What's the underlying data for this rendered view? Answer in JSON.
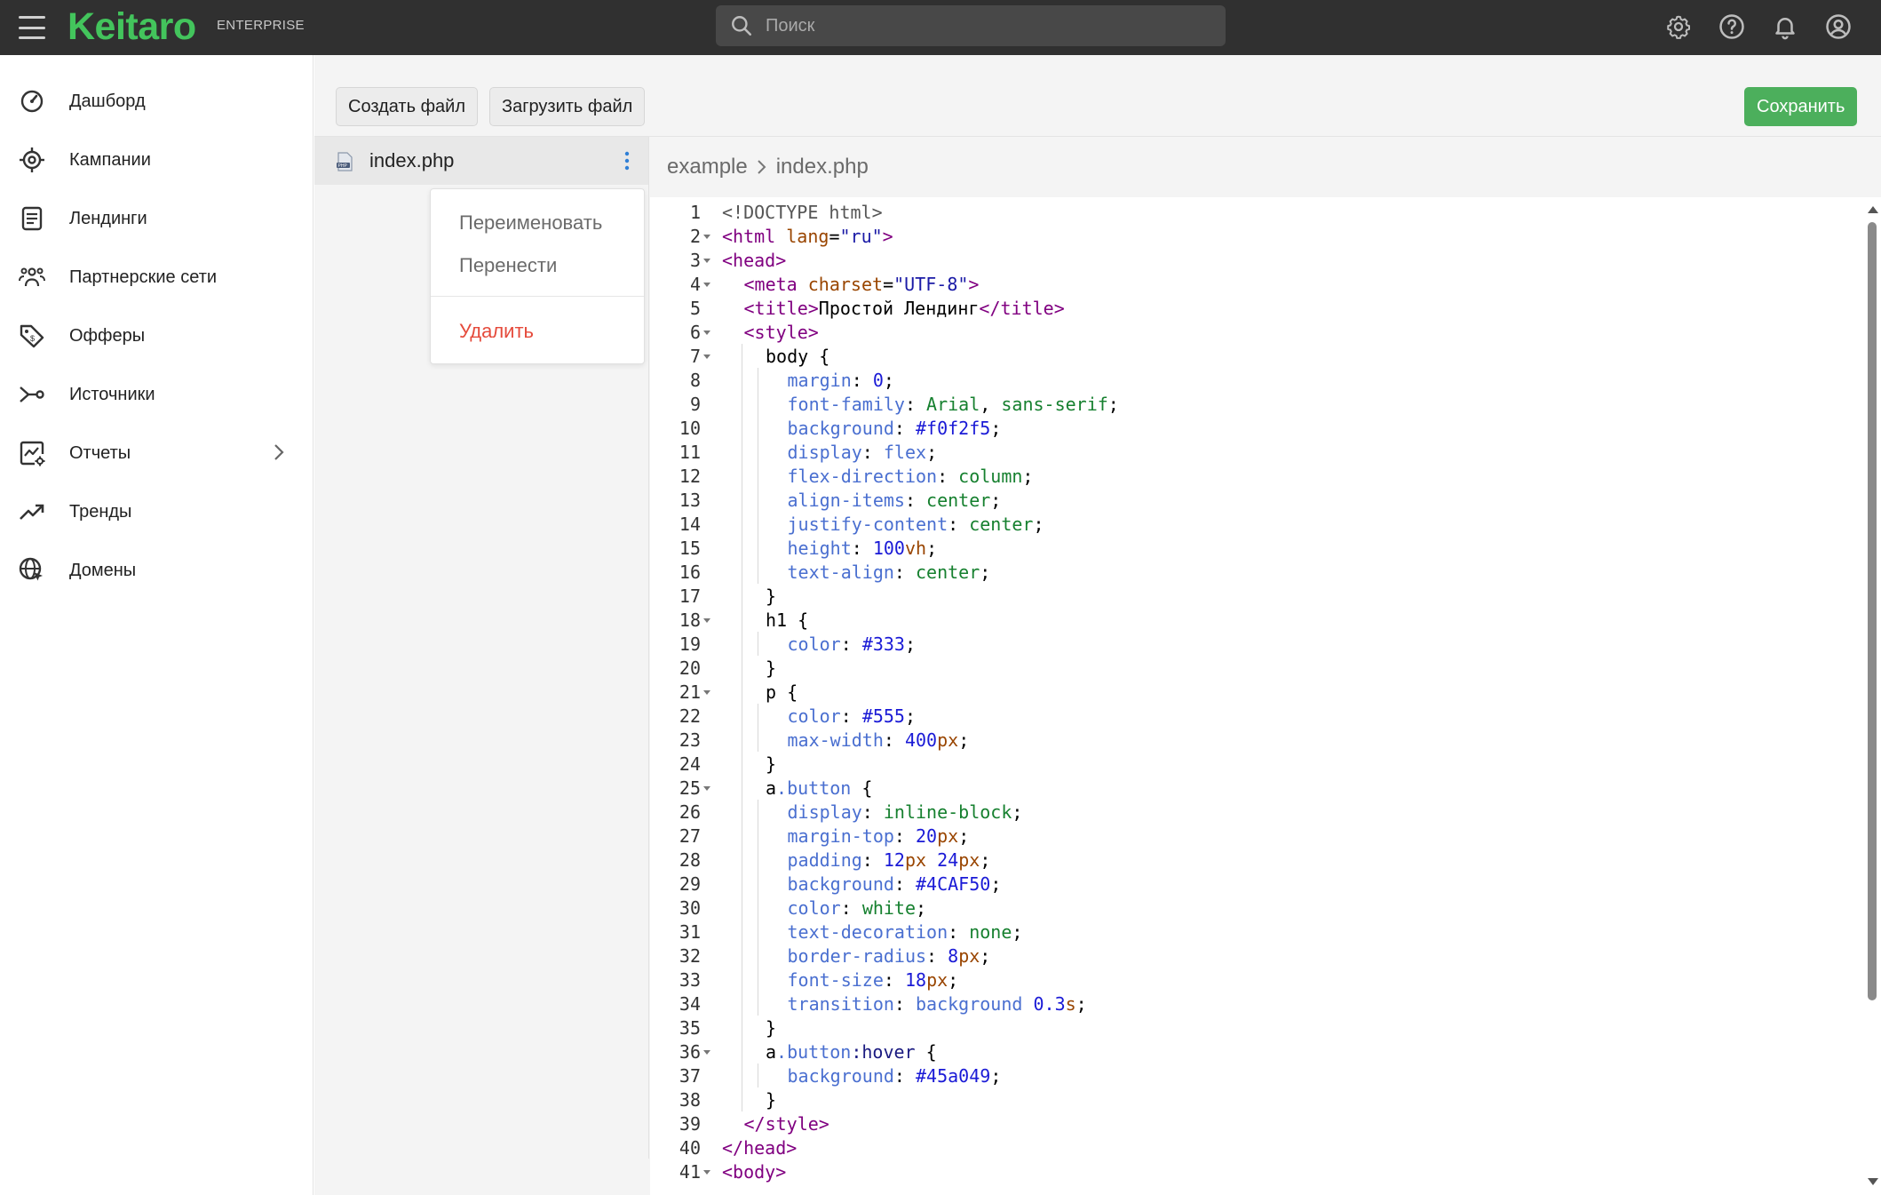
{
  "topbar": {
    "logo": "Keitaro",
    "logo_sub": "ENTERPRISE",
    "search_placeholder": "Поиск"
  },
  "sidebar": {
    "items": [
      {
        "label": "Дашборд",
        "icon": "dashboard-gauge-icon"
      },
      {
        "label": "Кампании",
        "icon": "target-icon"
      },
      {
        "label": "Лендинги",
        "icon": "document-icon"
      },
      {
        "label": "Партнерские сети",
        "icon": "people-group-icon"
      },
      {
        "label": "Офферы",
        "icon": "price-tag-icon"
      },
      {
        "label": "Источники",
        "icon": "source-branch-icon"
      },
      {
        "label": "Отчеты",
        "icon": "report-chart-icon"
      },
      {
        "label": "Тренды",
        "icon": "trend-arrow-icon"
      },
      {
        "label": "Домены",
        "icon": "globe-cursor-icon"
      }
    ]
  },
  "toolbar": {
    "create_label": "Создать файл",
    "upload_label": "Загрузить файл",
    "save_label": "Сохранить"
  },
  "files": {
    "selected": "index.php",
    "menu": {
      "rename": "Переименовать",
      "move": "Перенести",
      "delete": "Удалить"
    }
  },
  "breadcrumb": [
    "example",
    "index.php"
  ],
  "editor": {
    "lines": [
      {
        "n": "1",
        "fold": false,
        "indent": 0,
        "html": "<span class=\"t-doc\">&lt;!DOCTYPE html&gt;</span>"
      },
      {
        "n": "2",
        "fold": true,
        "indent": 0,
        "html": "<span class=\"t-tag\">&lt;html</span> <span class=\"t-attr\">lang</span>=<span class=\"t-str\">\"ru\"</span><span class=\"t-tag\">&gt;</span>"
      },
      {
        "n": "3",
        "fold": true,
        "indent": 0,
        "html": "<span class=\"t-tag\">&lt;head&gt;</span>"
      },
      {
        "n": "4",
        "fold": true,
        "indent": 1,
        "html": "<span class=\"t-tag\">&lt;meta</span> <span class=\"t-attr\">charset</span>=<span class=\"t-str\">\"UTF-8\"</span><span class=\"t-tag\">&gt;</span>"
      },
      {
        "n": "5",
        "fold": false,
        "indent": 1,
        "html": "<span class=\"t-tag\">&lt;title&gt;</span>Простой Лендинг<span class=\"t-tag\">&lt;/title&gt;</span>"
      },
      {
        "n": "6",
        "fold": true,
        "indent": 1,
        "html": "<span class=\"t-tag\">&lt;style&gt;</span>"
      },
      {
        "n": "7",
        "fold": true,
        "indent": 2,
        "html": "body {"
      },
      {
        "n": "8",
        "fold": false,
        "indent": 3,
        "html": "<span class=\"t-prop\">margin</span>: <span class=\"t-num\">0</span>;"
      },
      {
        "n": "9",
        "fold": false,
        "indent": 3,
        "html": "<span class=\"t-prop\">font-family</span>: <span class=\"t-kw\">Arial</span>, <span class=\"t-kw\">sans-serif</span>;"
      },
      {
        "n": "10",
        "fold": false,
        "indent": 3,
        "html": "<span class=\"t-prop\">background</span>: <span class=\"t-num\">#f0f2f5</span>;"
      },
      {
        "n": "11",
        "fold": false,
        "indent": 3,
        "html": "<span class=\"t-prop\">display</span>: <span class=\"t-prop\">flex</span>;"
      },
      {
        "n": "12",
        "fold": false,
        "indent": 3,
        "html": "<span class=\"t-prop\">flex-direction</span>: <span class=\"t-kw\">column</span>;"
      },
      {
        "n": "13",
        "fold": false,
        "indent": 3,
        "html": "<span class=\"t-prop\">align-items</span>: <span class=\"t-kw\">center</span>;"
      },
      {
        "n": "14",
        "fold": false,
        "indent": 3,
        "html": "<span class=\"t-prop\">justify-content</span>: <span class=\"t-kw\">center</span>;"
      },
      {
        "n": "15",
        "fold": false,
        "indent": 3,
        "html": "<span class=\"t-prop\">height</span>: <span class=\"t-num\">100</span><span class=\"t-attr\">vh</span>;"
      },
      {
        "n": "16",
        "fold": false,
        "indent": 3,
        "html": "<span class=\"t-prop\">text-align</span>: <span class=\"t-kw\">center</span>;"
      },
      {
        "n": "17",
        "fold": false,
        "indent": 2,
        "html": "}"
      },
      {
        "n": "18",
        "fold": true,
        "indent": 2,
        "html": "h1 {"
      },
      {
        "n": "19",
        "fold": false,
        "indent": 3,
        "html": "<span class=\"t-prop\">color</span>: <span class=\"t-num\">#333</span>;"
      },
      {
        "n": "20",
        "fold": false,
        "indent": 2,
        "html": "}"
      },
      {
        "n": "21",
        "fold": true,
        "indent": 2,
        "html": "p {"
      },
      {
        "n": "22",
        "fold": false,
        "indent": 3,
        "html": "<span class=\"t-prop\">color</span>: <span class=\"t-num\">#555</span>;"
      },
      {
        "n": "23",
        "fold": false,
        "indent": 3,
        "html": "<span class=\"t-prop\">max-width</span>: <span class=\"t-num\">400</span><span class=\"t-attr\">px</span>;"
      },
      {
        "n": "24",
        "fold": false,
        "indent": 2,
        "html": "}"
      },
      {
        "n": "25",
        "fold": true,
        "indent": 2,
        "html": "a<span class=\"t-prop\">.button</span> {"
      },
      {
        "n": "26",
        "fold": false,
        "indent": 3,
        "html": "<span class=\"t-prop\">display</span>: <span class=\"t-kw\">inline-block</span>;"
      },
      {
        "n": "27",
        "fold": false,
        "indent": 3,
        "html": "<span class=\"t-prop\">margin-top</span>: <span class=\"t-num\">20</span><span class=\"t-attr\">px</span>;"
      },
      {
        "n": "28",
        "fold": false,
        "indent": 3,
        "html": "<span class=\"t-prop\">padding</span>: <span class=\"t-num\">12</span><span class=\"t-attr\">px</span> <span class=\"t-num\">24</span><span class=\"t-attr\">px</span>;"
      },
      {
        "n": "29",
        "fold": false,
        "indent": 3,
        "html": "<span class=\"t-prop\">background</span>: <span class=\"t-num\">#4CAF50</span>;"
      },
      {
        "n": "30",
        "fold": false,
        "indent": 3,
        "html": "<span class=\"t-prop\">color</span>: <span class=\"t-kw\">white</span>;"
      },
      {
        "n": "31",
        "fold": false,
        "indent": 3,
        "html": "<span class=\"t-prop\">text-decoration</span>: <span class=\"t-kw\">none</span>;"
      },
      {
        "n": "32",
        "fold": false,
        "indent": 3,
        "html": "<span class=\"t-prop\">border-radius</span>: <span class=\"t-num\">8</span><span class=\"t-attr\">px</span>;"
      },
      {
        "n": "33",
        "fold": false,
        "indent": 3,
        "html": "<span class=\"t-prop\">font-size</span>: <span class=\"t-num\">18</span><span class=\"t-attr\">px</span>;"
      },
      {
        "n": "34",
        "fold": false,
        "indent": 3,
        "html": "<span class=\"t-prop\">transition</span>: <span class=\"t-prop\">background</span> <span class=\"t-num\">0.3</span><span class=\"t-attr\">s</span>;"
      },
      {
        "n": "35",
        "fold": false,
        "indent": 2,
        "html": "}"
      },
      {
        "n": "36",
        "fold": true,
        "indent": 2,
        "html": "a<span class=\"t-prop\">.button</span><span class=\"t-cls\">:hover</span> {"
      },
      {
        "n": "37",
        "fold": false,
        "indent": 3,
        "html": "<span class=\"t-prop\">background</span>: <span class=\"t-num\">#45a049</span>;"
      },
      {
        "n": "38",
        "fold": false,
        "indent": 2,
        "html": "}"
      },
      {
        "n": "39",
        "fold": false,
        "indent": 1,
        "html": "<span class=\"t-tag\">&lt;/style&gt;</span>"
      },
      {
        "n": "40",
        "fold": false,
        "indent": 0,
        "html": "<span class=\"t-tag\">&lt;/head&gt;</span>"
      },
      {
        "n": "41",
        "fold": true,
        "indent": 0,
        "html": "<span class=\"t-tag\">&lt;body&gt;</span>"
      }
    ]
  },
  "colors": {
    "brand": "#43c45c",
    "topbar": "#303030",
    "save_button": "#4caf5c",
    "delete": "#e54b3c"
  }
}
